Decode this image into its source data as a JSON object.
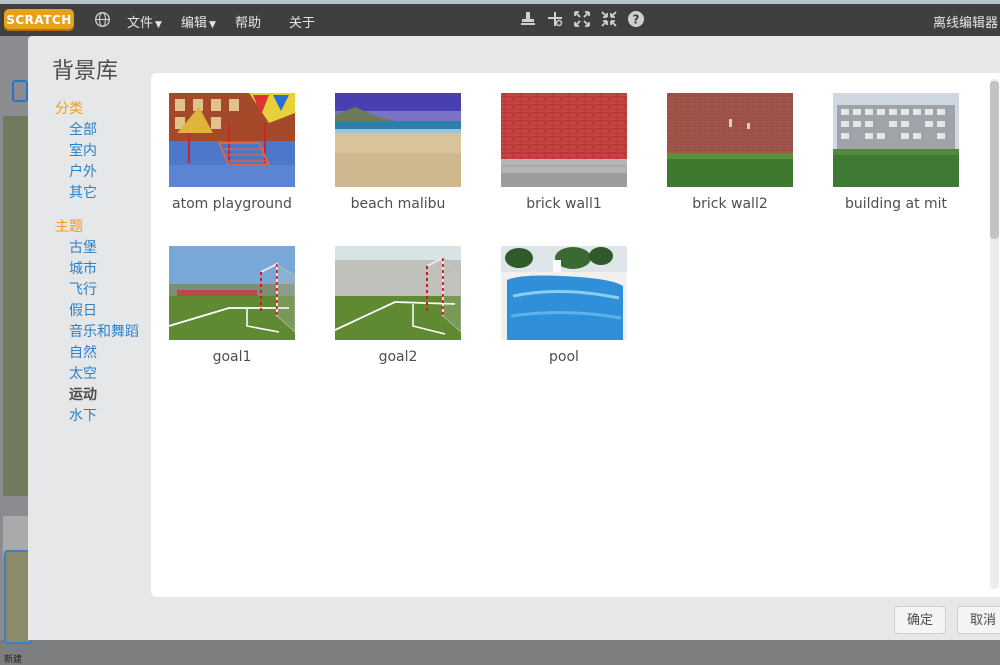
{
  "menubar": {
    "logo_text": "SCRATCH",
    "file": "文件",
    "edit": "编辑",
    "help": "帮助",
    "about": "关于",
    "offline_editor": "离线编辑器"
  },
  "background_left": {
    "new_label": "新建"
  },
  "dialog": {
    "title": "背景库",
    "category_heading": "分类",
    "categories": [
      "全部",
      "室内",
      "户外",
      "其它"
    ],
    "theme_heading": "主题",
    "themes": [
      "古堡",
      "城市",
      "飞行",
      "假日",
      "音乐和舞蹈",
      "自然",
      "太空",
      "运动",
      "水下"
    ],
    "active_theme": "运动",
    "ok_label": "确定",
    "cancel_label": "取消"
  },
  "backdrops": [
    {
      "name": "atom playground",
      "icon": "playground-thumbnail"
    },
    {
      "name": "beach malibu",
      "icon": "beach-thumbnail"
    },
    {
      "name": "brick wall1",
      "icon": "brick-wall-thumbnail"
    },
    {
      "name": "brick wall2",
      "icon": "brick-wall-grass-thumbnail"
    },
    {
      "name": "building at mit",
      "icon": "building-thumbnail"
    },
    {
      "name": "goal1",
      "icon": "soccer-goal-thumbnail"
    },
    {
      "name": "goal2",
      "icon": "soccer-goal-thumbnail"
    },
    {
      "name": "pool",
      "icon": "pool-thumbnail"
    }
  ],
  "colors": {
    "menubar": "#3f3f3f",
    "heading_orange": "#f19b22",
    "link_blue": "#2e80c5",
    "dialog_bg": "#e6e7e8"
  }
}
